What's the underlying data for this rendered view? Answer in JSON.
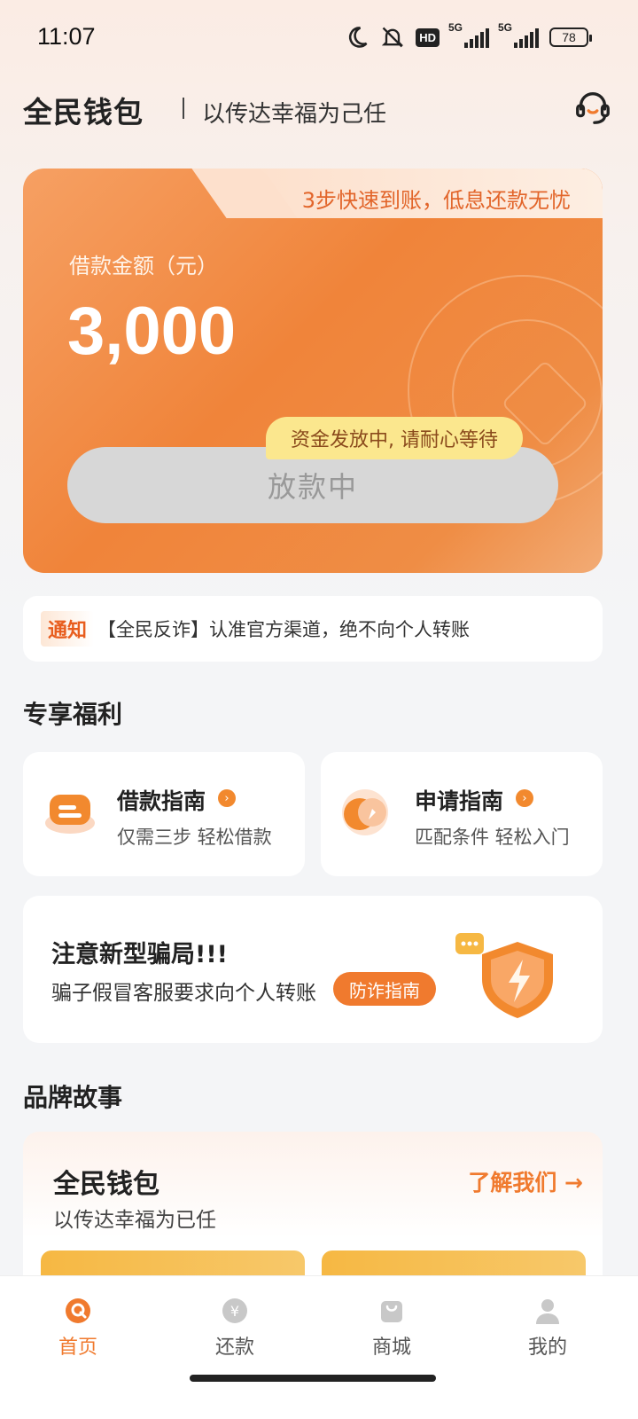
{
  "status_bar": {
    "time": "11:07",
    "hd_label": "HD",
    "signal1_label": "5G",
    "signal2_label": "5G",
    "battery": "78"
  },
  "header": {
    "brand": "全民钱包",
    "slogan": "以传达幸福为己任"
  },
  "loan_card": {
    "tab_text": "3步快速到账，低息还款无忧",
    "amount_label": "借款金额（元）",
    "amount": "3,000",
    "tooltip": "资金发放中, 请耐心等待",
    "button_label": "放款中"
  },
  "notice": {
    "tag": "通知",
    "text": "【全民反诈】认准官方渠道，绝不向个人转账"
  },
  "benefits": {
    "section_title": "专享福利",
    "items": [
      {
        "title": "借款指南",
        "subtitle": "仅需三步 轻松借款",
        "icon": "document-icon"
      },
      {
        "title": "申请指南",
        "subtitle": "匹配条件 轻松入门",
        "icon": "compass-icon"
      }
    ]
  },
  "scam_alert": {
    "title": "注意新型骗局!!!",
    "subtitle": "骗子假冒客服要求向个人转账",
    "button_label": "防诈指南"
  },
  "brand_story": {
    "section_title": "品牌故事",
    "title": "全民钱包",
    "subtitle": "以传达幸福为已任",
    "link_label": "了解我们 →"
  },
  "tabbar": {
    "items": [
      {
        "label": "首页",
        "icon": "home-icon",
        "active": true
      },
      {
        "label": "还款",
        "icon": "yen-icon",
        "active": false
      },
      {
        "label": "商城",
        "icon": "bag-icon",
        "active": false
      },
      {
        "label": "我的",
        "icon": "profile-icon",
        "active": false
      }
    ]
  },
  "colors": {
    "accent": "#f07a2e",
    "card_orange": "#f0843a",
    "tooltip_yellow": "#fbe78e",
    "background": "#f4f5f7"
  }
}
